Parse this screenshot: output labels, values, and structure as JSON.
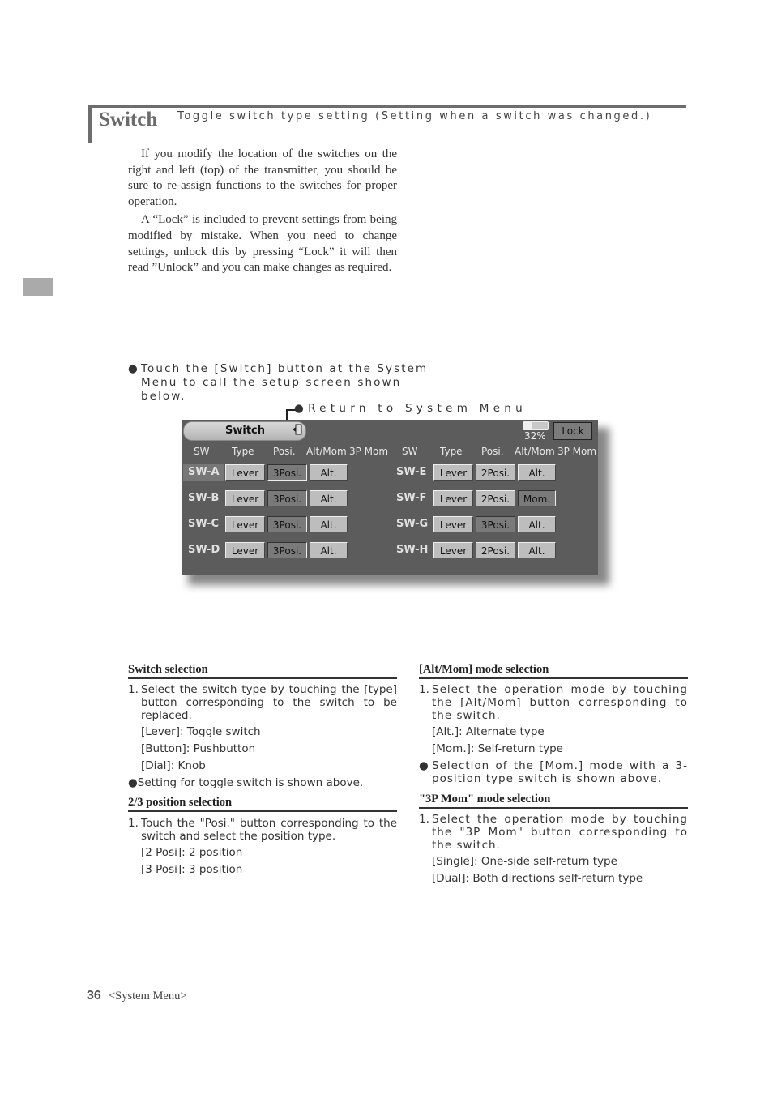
{
  "header": {
    "title": "Switch",
    "subtitle": "Toggle switch type setting (Setting when a switch was changed.)"
  },
  "intro": {
    "paragraphs": [
      "If you modify the location of the switches on the right and left (top) of the transmitter, you should be sure to re-assign functions to the switches for proper operation.",
      "A “Lock” is included to prevent settings from being modified by mistake. When you need to change settings, unlock this by pressing “Lock” it will then read ”Unlock” and you can make changes as required."
    ]
  },
  "instruction": {
    "bullet": "●",
    "text": "Touch the [Switch] button at the System Menu to call the setup screen shown below."
  },
  "callout": {
    "return_label": "●Return to System Menu"
  },
  "screen": {
    "title": "Switch",
    "return_icon": "←",
    "battery_percent": "32%",
    "battery_level": 0.32,
    "lock_label": "Lock",
    "columns": [
      "SW",
      "Type",
      "Posi.",
      "Alt/Mom",
      "3P Mom"
    ],
    "left_rows": [
      {
        "sw": "SW-A",
        "type": "Lever",
        "posi": "3Posi.",
        "mode": "Alt.",
        "selected": true,
        "posi_active": true,
        "mode_active": false
      },
      {
        "sw": "SW-B",
        "type": "Lever",
        "posi": "3Posi.",
        "mode": "Alt.",
        "selected": false,
        "posi_active": true,
        "mode_active": false
      },
      {
        "sw": "SW-C",
        "type": "Lever",
        "posi": "3Posi.",
        "mode": "Alt.",
        "selected": false,
        "posi_active": true,
        "mode_active": false
      },
      {
        "sw": "SW-D",
        "type": "Lever",
        "posi": "3Posi.",
        "mode": "Alt.",
        "selected": false,
        "posi_active": true,
        "mode_active": false
      }
    ],
    "right_rows": [
      {
        "sw": "SW-E",
        "type": "Lever",
        "posi": "2Posi.",
        "mode": "Alt.",
        "selected": false,
        "posi_active": false,
        "mode_active": false
      },
      {
        "sw": "SW-F",
        "type": "Lever",
        "posi": "2Posi.",
        "mode": "Mom.",
        "selected": false,
        "posi_active": false,
        "mode_active": true
      },
      {
        "sw": "SW-G",
        "type": "Lever",
        "posi": "3Posi.",
        "mode": "Alt.",
        "selected": false,
        "posi_active": true,
        "mode_active": false
      },
      {
        "sw": "SW-H",
        "type": "Lever",
        "posi": "2Posi.",
        "mode": "Alt.",
        "selected": false,
        "posi_active": false,
        "mode_active": false
      }
    ]
  },
  "sections": {
    "switch_selection": {
      "heading": "Switch selection",
      "num": "1.",
      "text": "Select the switch type by touching the [type] button corresponding to the switch to be replaced.",
      "items": [
        "[Lever]: Toggle switch",
        "[Button]: Pushbutton",
        "[Dial]: Knob"
      ],
      "note": "●Setting for toggle switch is shown above."
    },
    "position_selection": {
      "heading": "2/3 position selection",
      "num": "1.",
      "text": "Touch the \"Posi.\" button corresponding to the switch and select the position type.",
      "items": [
        "[2 Posi]: 2 position",
        "[3 Posi]: 3 position"
      ]
    },
    "altmom_selection": {
      "heading": "[Alt/Mom] mode selection",
      "num": "1.",
      "text": "Select the operation mode by touching the [Alt/Mom] button corresponding to the switch.",
      "items": [
        "[Alt.]: Alternate type",
        "[Mom.]: Self-return type"
      ],
      "note_bullet": "●",
      "note": "Selection of the [Mom.] mode with a 3-position type switch is shown above."
    },
    "threep_selection": {
      "heading": "\"3P Mom\" mode selection",
      "num": "1.",
      "text": "Select the operation mode by touching the \"3P Mom\" button corresponding to the switch.",
      "items": [
        "[Single]: One-side self-return type",
        "[Dual]: Both directions self-return type"
      ]
    }
  },
  "footer": {
    "page_number": "36",
    "section": "<System Menu>"
  }
}
